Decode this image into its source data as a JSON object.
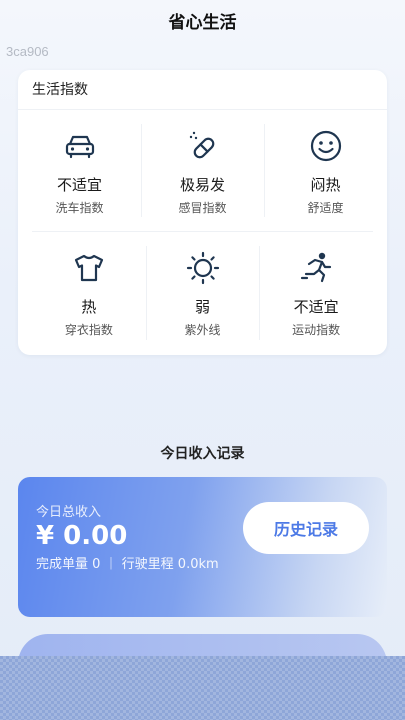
{
  "header": {
    "title": "省心生活"
  },
  "watermark": "3ca906",
  "life_index": {
    "title": "生活指数",
    "items": [
      {
        "icon": "car-icon",
        "value": "不适宜",
        "label": "洗车指数"
      },
      {
        "icon": "pill-icon",
        "value": "极易发",
        "label": "感冒指数"
      },
      {
        "icon": "smiley-icon",
        "value": "闷热",
        "label": "舒适度"
      },
      {
        "icon": "tshirt-icon",
        "value": "热",
        "label": "穿衣指数"
      },
      {
        "icon": "sun-icon",
        "value": "弱",
        "label": "紫外线"
      },
      {
        "icon": "runner-icon",
        "value": "不适宜",
        "label": "运动指数"
      }
    ]
  },
  "income_section": {
    "title": "今日收入记录",
    "total_label": "今日总收入",
    "amount": "¥ 0.00",
    "meta": "完成单量 0 ｜ 行驶里程 0.0km",
    "history_button": "历史记录"
  },
  "colors": {
    "accent": "#4d7ae6",
    "card_gradient_start": "#5b86ee",
    "icon_stroke": "#1f3650"
  }
}
